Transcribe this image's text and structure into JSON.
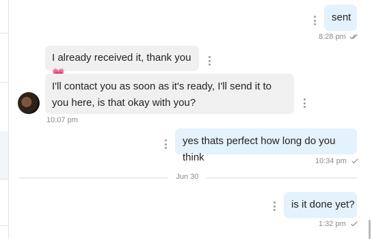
{
  "messages": [
    {
      "id": "m1",
      "direction": "out",
      "text": "sent",
      "time": "8:28 pm",
      "status": "read"
    },
    {
      "id": "m2",
      "direction": "in",
      "text": "I already received it, thank you",
      "emoji": "💗"
    },
    {
      "id": "m3",
      "direction": "in",
      "text": "I'll contact you as soon as it's ready, I'll send it to you here, is that okay with you?",
      "time": "10:07 pm"
    },
    {
      "id": "m4",
      "direction": "out",
      "text": "yes thats perfect how long do you think",
      "time": "10:34 pm",
      "status": "sent"
    },
    {
      "id": "m5",
      "direction": "out",
      "text": "is it done yet?",
      "time": "1:32 pm",
      "status": "sent"
    }
  ],
  "date_divider": "Jun 30",
  "icons": {
    "more": "more-vertical-icon",
    "read": "double-check-icon",
    "sent": "check-icon"
  },
  "colors": {
    "outgoing_bubble": "#e3f2fc",
    "incoming_bubble": "#f0f0f1",
    "meta_text": "#8a8a8a"
  }
}
